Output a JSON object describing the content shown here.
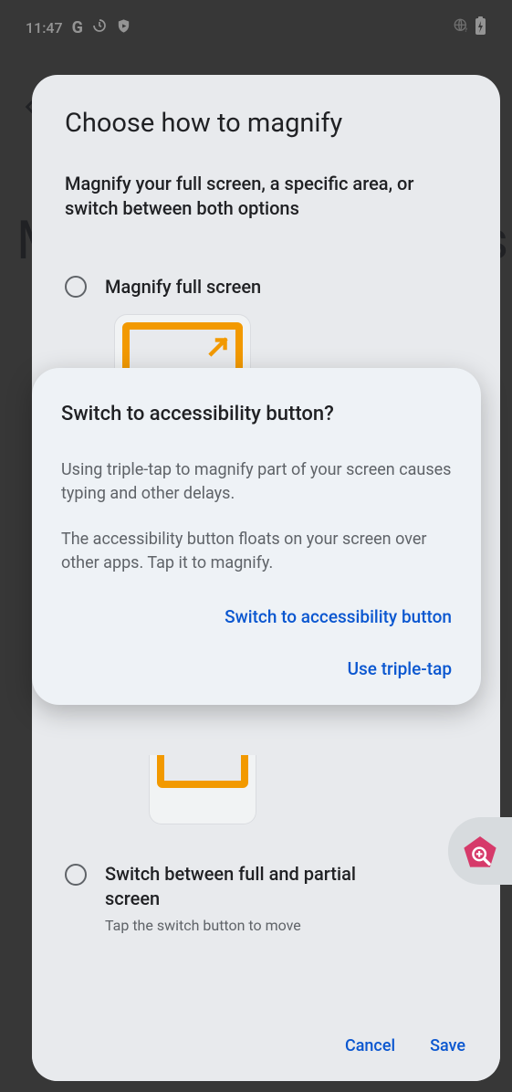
{
  "statusbar": {
    "time": "11:47"
  },
  "background_page": {
    "title": "Choose how to magnify",
    "subtitle": "Magnify your full screen, a specific area, or switch between both options",
    "option1_label": "Magnify full screen",
    "option2_label": "Switch between full and partial screen",
    "option2_sub": "Tap the switch button to move",
    "cancel": "Cancel",
    "save": "Save"
  },
  "dialog": {
    "title": "Switch to accessibility button?",
    "body1": "Using triple-tap to magnify part of your screen causes typing and other delays.",
    "body2": "The accessibility button floats on your screen over other apps. Tap it to magnify.",
    "action_primary": "Switch to accessibility button",
    "action_secondary": "Use triple-tap"
  }
}
